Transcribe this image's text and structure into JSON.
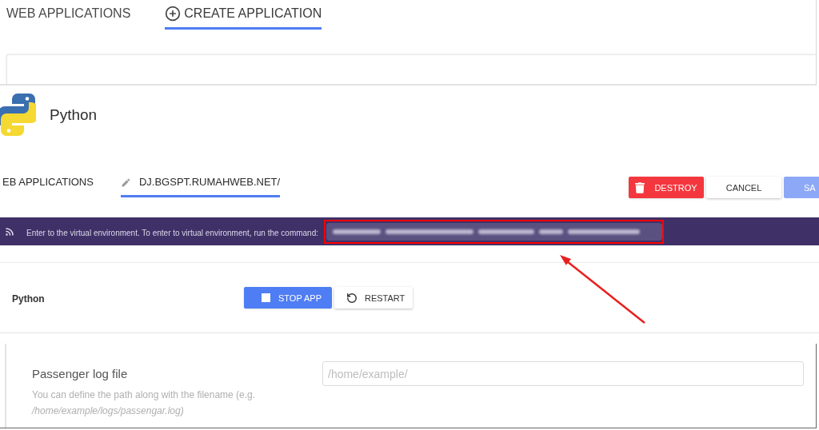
{
  "top_section": {
    "tabs": [
      {
        "label": "WEB APPLICATIONS",
        "selected": false,
        "kind": "plain"
      },
      {
        "label": "CREATE APPLICATION",
        "selected": true,
        "kind": "create"
      }
    ]
  },
  "app_header": {
    "title": "Python"
  },
  "edit_section": {
    "tabs": [
      {
        "label": "EB APPLICATIONS",
        "selected": false,
        "kind": "plain"
      },
      {
        "label": "DJ.BGSPT.RUMAHWEB.NET/",
        "selected": true,
        "kind": "edit"
      }
    ],
    "buttons": [
      {
        "label": "DESTROY",
        "kind": "danger",
        "disabled": false
      },
      {
        "label": "CANCEL",
        "kind": "secondary",
        "disabled": false
      },
      {
        "label": "SA",
        "kind": "primary",
        "disabled": true
      }
    ]
  },
  "banner": {
    "message": "Enter to the virtual environment. To enter to virtual environment, run the command:"
  },
  "app_control": {
    "label": "Python",
    "buttons": [
      {
        "label": "STOP APP",
        "kind": "stop"
      },
      {
        "label": "RESTART",
        "kind": "restart"
      }
    ]
  },
  "passenger_log": {
    "label": "Passenger log file",
    "help": "You can define the path along with the filename (e.g. */home/example/logs/passengar.log)*",
    "placeholder": "/home/example/"
  }
}
